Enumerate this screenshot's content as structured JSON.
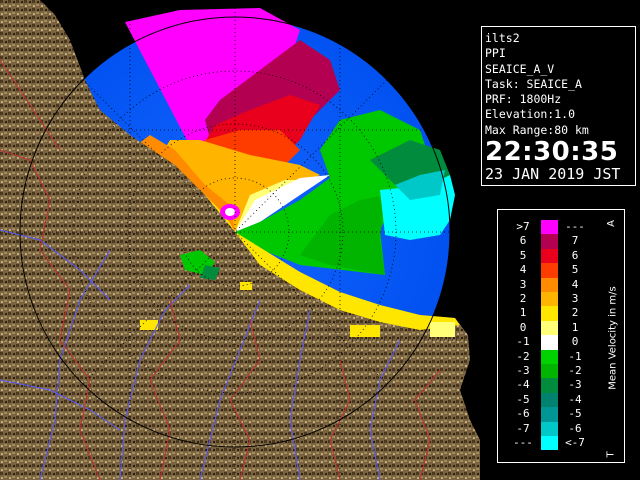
{
  "info": {
    "site": "ilts2",
    "mode": "PPI",
    "product": "SEAICE_A_V",
    "task": "Task: SEAICE_A",
    "prf": "PRF: 1800Hz",
    "elevation": "Elevation:1.0",
    "max_range": "Max Range:80 km",
    "time": "22:30:35",
    "date": "23 JAN 2019 JST"
  },
  "legend": {
    "title": "Mean Velocity in m/s",
    "top_tag": "A",
    "bottom_tag": "T",
    "rows": [
      {
        "left": ">7",
        "right": "---",
        "color": "#ff00ff"
      },
      {
        "left": "6",
        "right": "7",
        "color": "#b40050"
      },
      {
        "left": "5",
        "right": "6",
        "color": "#e8001c"
      },
      {
        "left": "4",
        "right": "5",
        "color": "#ff3c00"
      },
      {
        "left": "3",
        "right": "4",
        "color": "#ff8c00"
      },
      {
        "left": "2",
        "right": "3",
        "color": "#ffb400"
      },
      {
        "left": "1",
        "right": "2",
        "color": "#ffe600"
      },
      {
        "left": "0",
        "right": "1",
        "color": "#ffff78"
      },
      {
        "left": "-1",
        "right": "0",
        "color": "#ffffff"
      },
      {
        "left": "-2",
        "right": "-1",
        "color": "#00d200"
      },
      {
        "left": "-3",
        "right": "-2",
        "color": "#00b400"
      },
      {
        "left": "-4",
        "right": "-3",
        "color": "#008c3c"
      },
      {
        "left": "-5",
        "right": "-4",
        "color": "#00826e"
      },
      {
        "left": "-6",
        "right": "-5",
        "color": "#009696"
      },
      {
        "left": "-7",
        "right": "-6",
        "color": "#00c8c8"
      },
      {
        "left": "---",
        "right": "<-7",
        "color": "#00ffff"
      }
    ]
  },
  "colors": {
    "sea_echo_free": "#1464ff",
    "land": "#7a6440",
    "land_dark": "#3c2c18",
    "rivers": "#5a5aff",
    "boundaries": "#c03030",
    "range_rings": "#000000"
  }
}
